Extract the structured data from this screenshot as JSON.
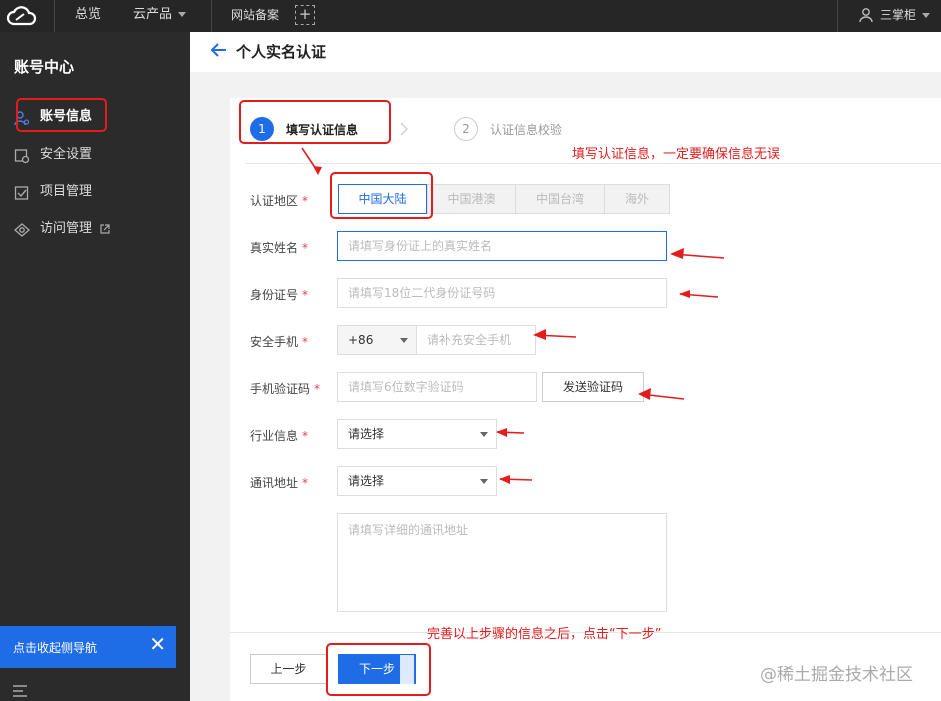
{
  "topbar": {
    "nav_overview": "总览",
    "nav_products": "云产品",
    "nav_icp": "网站备案",
    "plus": "+",
    "user_name": "三掌柜"
  },
  "sidebar": {
    "title": "账号中心",
    "items": [
      {
        "label": "账号信息",
        "icon": "account-icon"
      },
      {
        "label": "安全设置",
        "icon": "shield-icon"
      },
      {
        "label": "项目管理",
        "icon": "checkbox-icon"
      },
      {
        "label": "访问管理",
        "icon": "eye-icon"
      }
    ],
    "collapse_text": "点击收起侧导航",
    "collapse_close": "✕"
  },
  "header": {
    "title": "个人实名认证"
  },
  "steps": [
    {
      "num": "1",
      "label": "填写认证信息"
    },
    {
      "num": "2",
      "label": "认证信息校验"
    }
  ],
  "form": {
    "region": {
      "label": "认证地区",
      "options": [
        "中国大陆",
        "中国港澳",
        "中国台湾",
        "海外"
      ],
      "selected": "中国大陆"
    },
    "name": {
      "label": "真实姓名",
      "placeholder": "请填写身份证上的真实姓名"
    },
    "id_number": {
      "label": "身份证号",
      "placeholder": "请填写18位二代身份证号码"
    },
    "phone": {
      "label": "安全手机",
      "country_code": "+86",
      "placeholder": "请补充安全手机"
    },
    "sms_code": {
      "label": "手机验证码",
      "placeholder": "请填写6位数字验证码",
      "send_button": "发送验证码"
    },
    "industry": {
      "label": "行业信息",
      "value": "请选择"
    },
    "address": {
      "label": "通讯地址",
      "value": "请选择",
      "detail_placeholder": "请填写详细的通讯地址"
    },
    "required_mark": "*"
  },
  "buttons": {
    "prev": "上一步",
    "next": "下一步"
  },
  "annotations": {
    "top_note": "填写认证信息，一定要确保信息无误",
    "bottom_note": "完善以上步骤的信息之后，点击“下一步”"
  },
  "watermark": "@稀土掘金技术社区",
  "colors": {
    "accent": "#1f6de6",
    "annotation_red": "#e51c1c",
    "topbar_bg": "#262626",
    "sidebar_bg": "#2b2b2b"
  }
}
